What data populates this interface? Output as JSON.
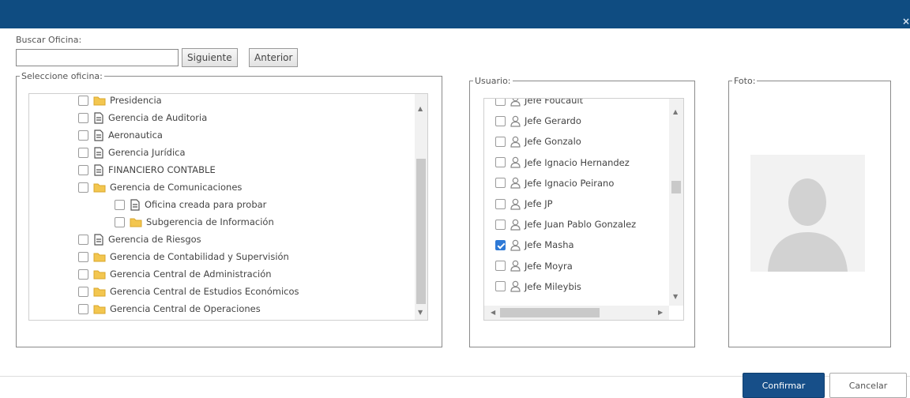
{
  "search": {
    "label": "Buscar Oficina:",
    "value": "",
    "next_label": "Siguiente",
    "prev_label": "Anterior"
  },
  "offices": {
    "legend": "Seleccione oficina:",
    "items": [
      {
        "label": "Presidencia",
        "type": "folder",
        "level": 1,
        "checked": false
      },
      {
        "label": "Gerencia de Auditoria",
        "type": "doc",
        "level": 1,
        "checked": false
      },
      {
        "label": "Aeronautica",
        "type": "doc",
        "level": 1,
        "checked": false
      },
      {
        "label": "Gerencia Jurídica",
        "type": "doc",
        "level": 1,
        "checked": false
      },
      {
        "label": "FINANCIERO CONTABLE",
        "type": "doc",
        "level": 1,
        "checked": false
      },
      {
        "label": "Gerencia de Comunicaciones",
        "type": "folder",
        "level": 1,
        "checked": false
      },
      {
        "label": "Oficina creada para probar",
        "type": "doc",
        "level": 2,
        "checked": false
      },
      {
        "label": "Subgerencia de Información",
        "type": "folder",
        "level": 2,
        "checked": false
      },
      {
        "label": "Gerencia de Riesgos",
        "type": "doc",
        "level": 1,
        "checked": false
      },
      {
        "label": "Gerencia de Contabilidad y Supervisión",
        "type": "folder",
        "level": 1,
        "checked": false
      },
      {
        "label": "Gerencia Central de Administración",
        "type": "folder",
        "level": 1,
        "checked": false
      },
      {
        "label": "Gerencia Central de Estudios Económicos",
        "type": "folder",
        "level": 1,
        "checked": false
      },
      {
        "label": "Gerencia Central de Operaciones",
        "type": "folder",
        "level": 1,
        "checked": false
      }
    ]
  },
  "users": {
    "legend": "Usuario:",
    "items": [
      {
        "label": "Jefe Foucault",
        "checked": false
      },
      {
        "label": "Jefe Gerardo",
        "checked": false
      },
      {
        "label": "Jefe Gonzalo",
        "checked": false
      },
      {
        "label": "Jefe Ignacio Hernandez",
        "checked": false
      },
      {
        "label": "Jefe Ignacio Peirano",
        "checked": false
      },
      {
        "label": "Jefe JP",
        "checked": false
      },
      {
        "label": "Jefe Juan Pablo Gonzalez",
        "checked": false
      },
      {
        "label": "Jefe Masha",
        "checked": true
      },
      {
        "label": "Jefe Moyra",
        "checked": false
      },
      {
        "label": "Jefe Mileybis",
        "checked": false
      }
    ]
  },
  "photo": {
    "legend": "Foto:"
  },
  "footer": {
    "confirm_label": "Confirmar",
    "cancel_label": "Cancelar"
  },
  "colors": {
    "titlebar": "#0f4c81",
    "primary": "#174f89",
    "checkbox_checked": "#2e79d6"
  }
}
